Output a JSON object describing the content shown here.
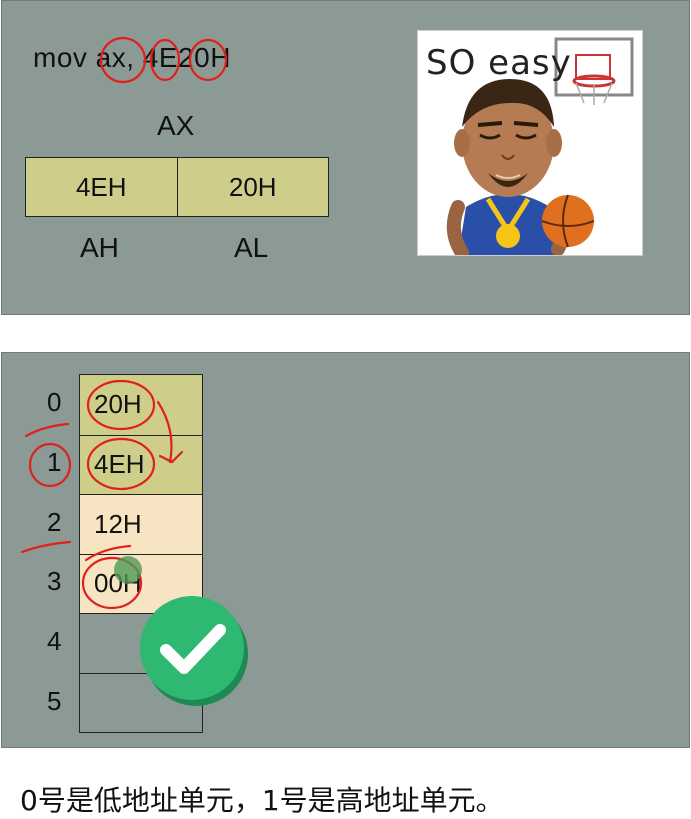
{
  "top_panel": {
    "instruction": "mov ax, 4E20H",
    "register_name": "AX",
    "high_byte": "4EH",
    "low_byte": "20H",
    "high_label": "AH",
    "low_label": "AL",
    "sticker_text": "SO easy"
  },
  "memory": {
    "addresses": [
      "0",
      "1",
      "2",
      "3",
      "4",
      "5"
    ],
    "cells": [
      "20H",
      "4EH",
      "12H",
      "00H",
      "",
      ""
    ]
  },
  "caption": "0号是低地址单元，1号是高地址单元。",
  "colors": {
    "panel": "#8c9a95",
    "register_fill": "#cfcd8a",
    "memory_fill": "#f6e4c2",
    "annotation": "#e0201a",
    "check": "#2eb872"
  }
}
